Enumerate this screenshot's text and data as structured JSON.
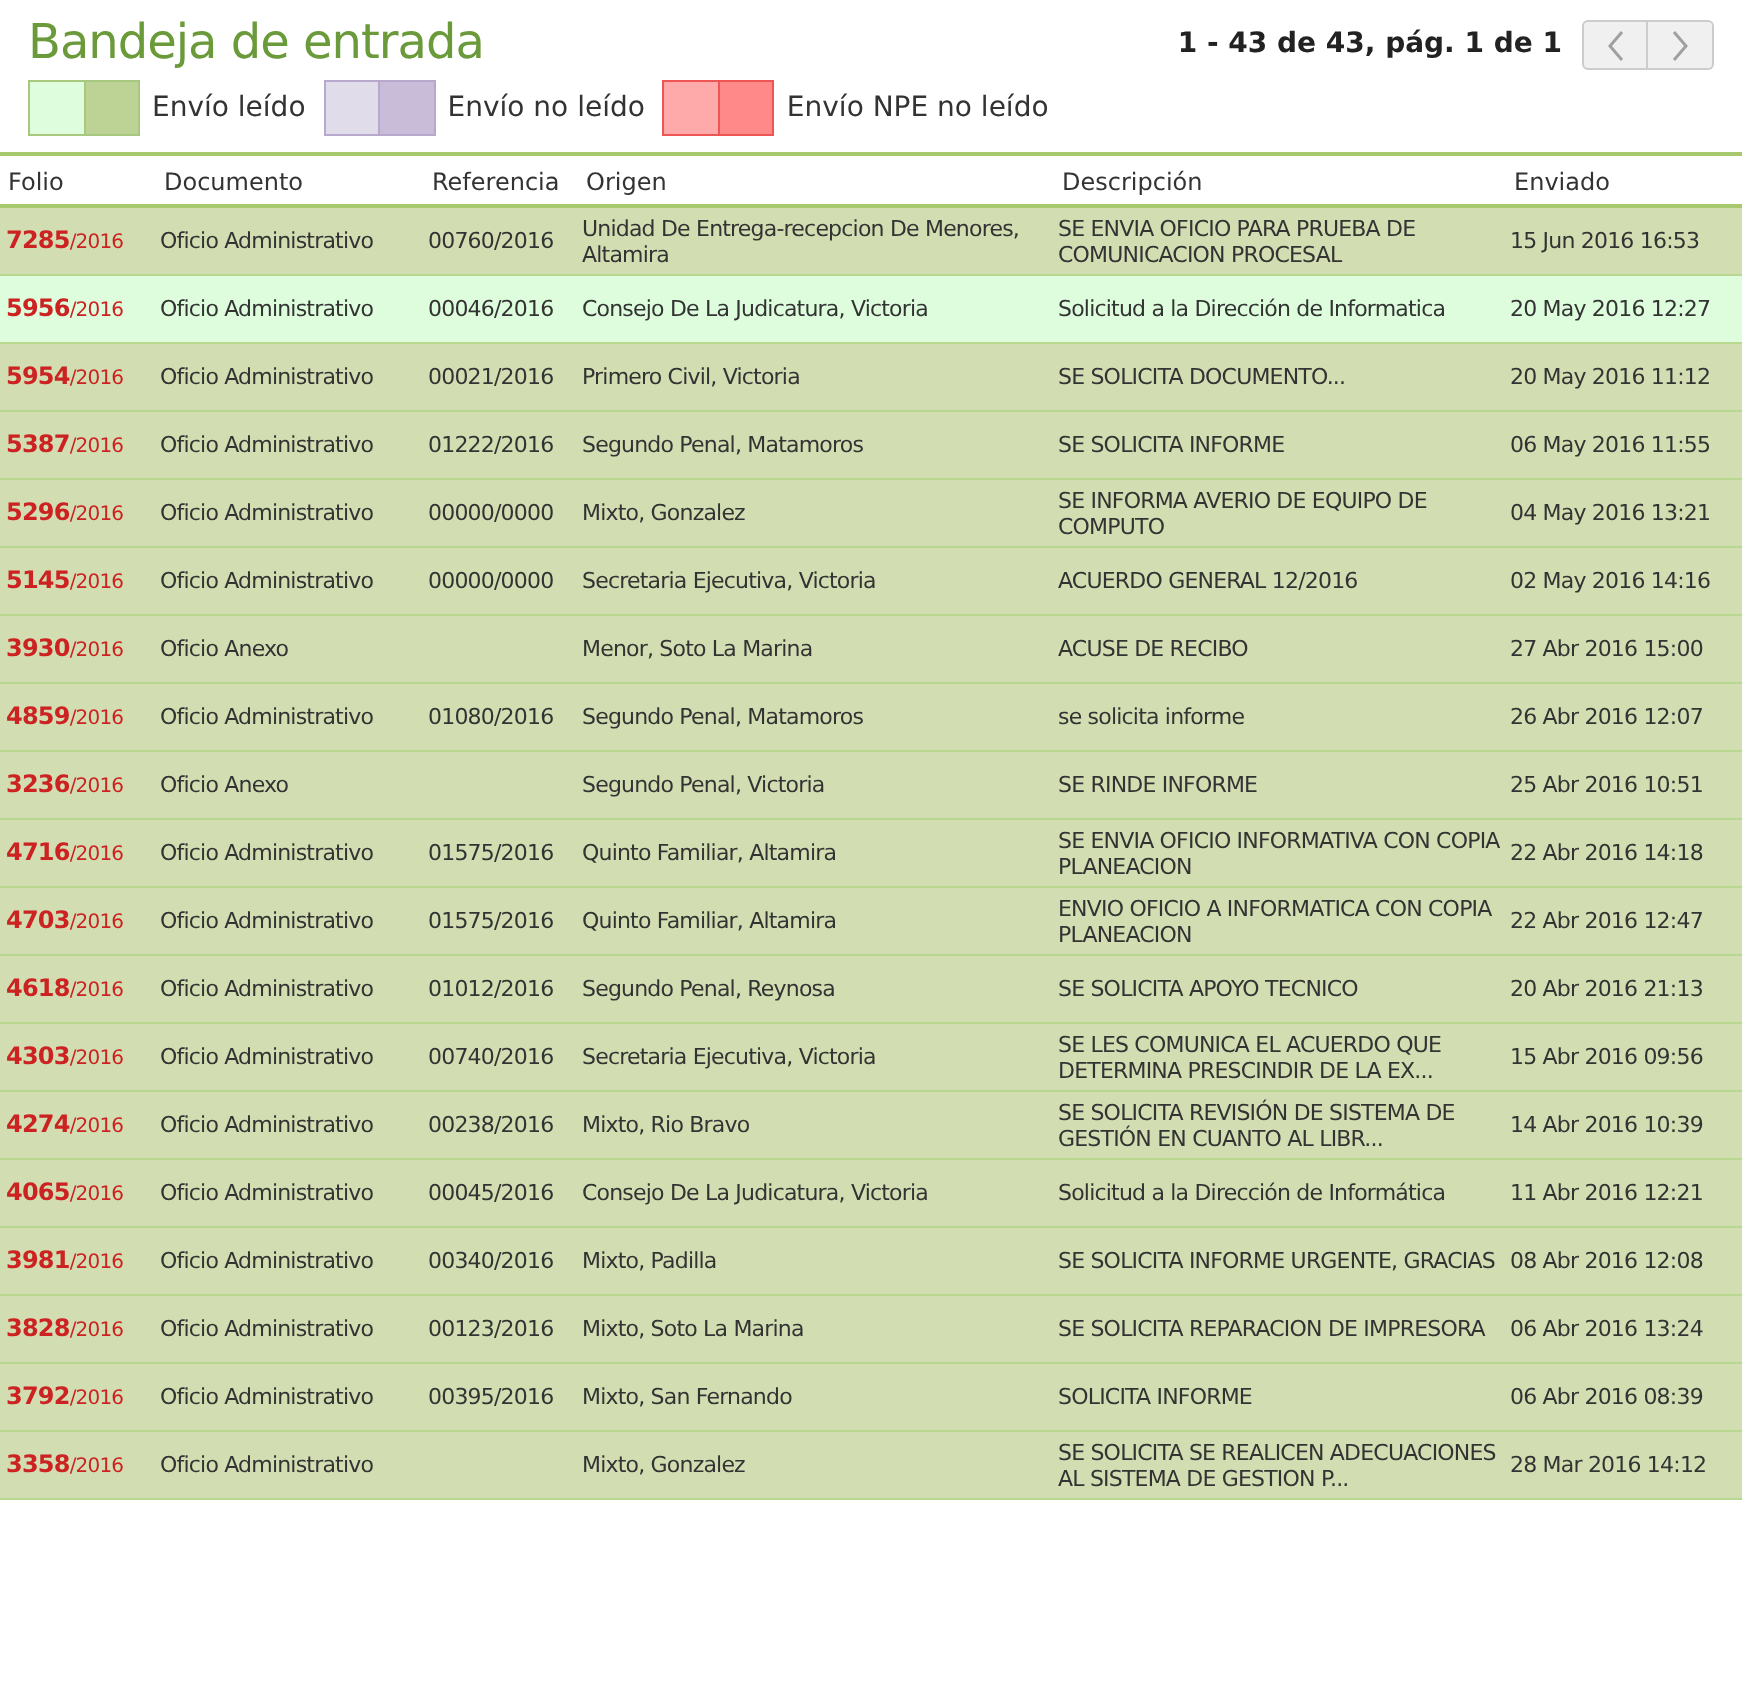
{
  "title": "Bandeja de entrada",
  "pagination": {
    "summary": "1 - 43 de 43, pág. 1 de 1",
    "prev_disabled": true,
    "next_disabled": true
  },
  "legend": [
    {
      "label": "Envío leído",
      "kind": "read"
    },
    {
      "label": "Envío no leído",
      "kind": "unread"
    },
    {
      "label": "Envío NPE no leído",
      "kind": "npe"
    }
  ],
  "table": {
    "columns": [
      "Folio",
      "Documento",
      "Referencia",
      "Origen",
      "Descripción",
      "Enviado"
    ],
    "rows": [
      {
        "folio": "7285",
        "year": "/2016",
        "documento": "Oficio Administrativo",
        "referencia": "00760/2016",
        "origen": "Unidad De Entrega-recepcion De Menores, Altamira",
        "descripcion": "SE ENVIA OFICIO PARA PRUEBA DE COMUNICACION PROCESAL",
        "enviado": "15 Jun 2016 16:53",
        "selected": false
      },
      {
        "folio": "5956",
        "year": "/2016",
        "documento": "Oficio Administrativo",
        "referencia": "00046/2016",
        "origen": "Consejo De La Judicatura, Victoria",
        "descripcion": "Solicitud a la Dirección de Informatica",
        "enviado": "20 May 2016 12:27",
        "selected": true
      },
      {
        "folio": "5954",
        "year": "/2016",
        "documento": "Oficio Administrativo",
        "referencia": "00021/2016",
        "origen": "Primero Civil, Victoria",
        "descripcion": "SE SOLICITA DOCUMENTO...",
        "enviado": "20 May 2016 11:12",
        "selected": false
      },
      {
        "folio": "5387",
        "year": "/2016",
        "documento": "Oficio Administrativo",
        "referencia": "01222/2016",
        "origen": "Segundo Penal, Matamoros",
        "descripcion": "SE SOLICITA INFORME",
        "enviado": "06 May 2016 11:55",
        "selected": false
      },
      {
        "folio": "5296",
        "year": "/2016",
        "documento": "Oficio Administrativo",
        "referencia": "00000/0000",
        "origen": "Mixto, Gonzalez",
        "descripcion": "SE INFORMA AVERIO DE EQUIPO DE COMPUTO",
        "enviado": "04 May 2016 13:21",
        "selected": false
      },
      {
        "folio": "5145",
        "year": "/2016",
        "documento": "Oficio Administrativo",
        "referencia": "00000/0000",
        "origen": "Secretaria Ejecutiva, Victoria",
        "descripcion": "ACUERDO GENERAL 12/2016",
        "enviado": "02 May 2016 14:16",
        "selected": false
      },
      {
        "folio": "3930",
        "year": "/2016",
        "documento": "Oficio Anexo",
        "origen": "Menor, Soto La Marina",
        "descripcion": "ACUSE DE RECIBO",
        "enviado": "27 Abr 2016 15:00",
        "selected": false
      },
      {
        "folio": "4859",
        "year": "/2016",
        "documento": "Oficio Administrativo",
        "referencia": "01080/2016",
        "origen": "Segundo Penal, Matamoros",
        "descripcion": "se solicita informe",
        "enviado": "26 Abr 2016 12:07",
        "selected": false
      },
      {
        "folio": "3236",
        "year": "/2016",
        "documento": "Oficio Anexo",
        "origen": "Segundo Penal, Victoria",
        "descripcion": "SE RINDE INFORME",
        "enviado": "25 Abr 2016 10:51",
        "selected": false
      },
      {
        "folio": "4716",
        "year": "/2016",
        "documento": "Oficio Administrativo",
        "referencia": "01575/2016",
        "origen": "Quinto Familiar, Altamira",
        "descripcion": "SE ENVIA OFICIO INFORMATIVA CON COPIA PLANEACION",
        "enviado": "22 Abr 2016 14:18",
        "selected": false
      },
      {
        "folio": "4703",
        "year": "/2016",
        "documento": "Oficio Administrativo",
        "referencia": "01575/2016",
        "origen": "Quinto Familiar, Altamira",
        "descripcion": "ENVIO OFICIO A INFORMATICA CON COPIA PLANEACION",
        "enviado": "22 Abr 2016 12:47",
        "selected": false
      },
      {
        "folio": "4618",
        "year": "/2016",
        "documento": "Oficio Administrativo",
        "referencia": "01012/2016",
        "origen": "Segundo Penal, Reynosa",
        "descripcion": "SE SOLICITA APOYO TECNICO",
        "enviado": "20 Abr 2016 21:13",
        "selected": false
      },
      {
        "folio": "4303",
        "year": "/2016",
        "documento": "Oficio Administrativo",
        "referencia": "00740/2016",
        "origen": "Secretaria Ejecutiva, Victoria",
        "descripcion": "SE LES COMUNICA EL ACUERDO QUE DETERMINA PRESCINDIR DE LA EX...",
        "enviado": "15 Abr 2016 09:56",
        "selected": false
      },
      {
        "folio": "4274",
        "year": "/2016",
        "documento": "Oficio Administrativo",
        "referencia": "00238/2016",
        "origen": "Mixto, Rio Bravo",
        "descripcion": "SE SOLICITA REVISIÓN DE SISTEMA DE GESTIÓN EN CUANTO AL LIBR...",
        "enviado": "14 Abr 2016 10:39",
        "selected": false
      },
      {
        "folio": "4065",
        "year": "/2016",
        "documento": "Oficio Administrativo",
        "referencia": "00045/2016",
        "origen": "Consejo De La Judicatura, Victoria",
        "descripcion": "Solicitud a la Dirección de Informática",
        "enviado": "11 Abr 2016 12:21",
        "selected": false
      },
      {
        "folio": "3981",
        "year": "/2016",
        "documento": "Oficio Administrativo",
        "referencia": "00340/2016",
        "origen": "Mixto, Padilla",
        "descripcion": "SE SOLICITA INFORME URGENTE, GRACIAS",
        "enviado": "08 Abr 2016 12:08",
        "selected": false
      },
      {
        "folio": "3828",
        "year": "/2016",
        "documento": "Oficio Administrativo",
        "referencia": "00123/2016",
        "origen": "Mixto, Soto La Marina",
        "descripcion": "SE SOLICITA REPARACION DE IMPRESORA",
        "enviado": "06 Abr 2016 13:24",
        "selected": false
      },
      {
        "folio": "3792",
        "year": "/2016",
        "documento": "Oficio Administrativo",
        "referencia": "00395/2016",
        "origen": "Mixto, San Fernando",
        "descripcion": "SOLICITA INFORME",
        "enviado": "06 Abr 2016 08:39",
        "selected": false
      },
      {
        "folio": "3358",
        "year": "/2016",
        "documento": "Oficio Administrativo",
        "origen": "Mixto, Gonzalez",
        "descripcion": "SE SOLICITA SE REALICEN ADECUACIONES AL SISTEMA DE GESTION P...",
        "enviado": "28 Mar 2016 14:12",
        "selected": false
      }
    ]
  }
}
